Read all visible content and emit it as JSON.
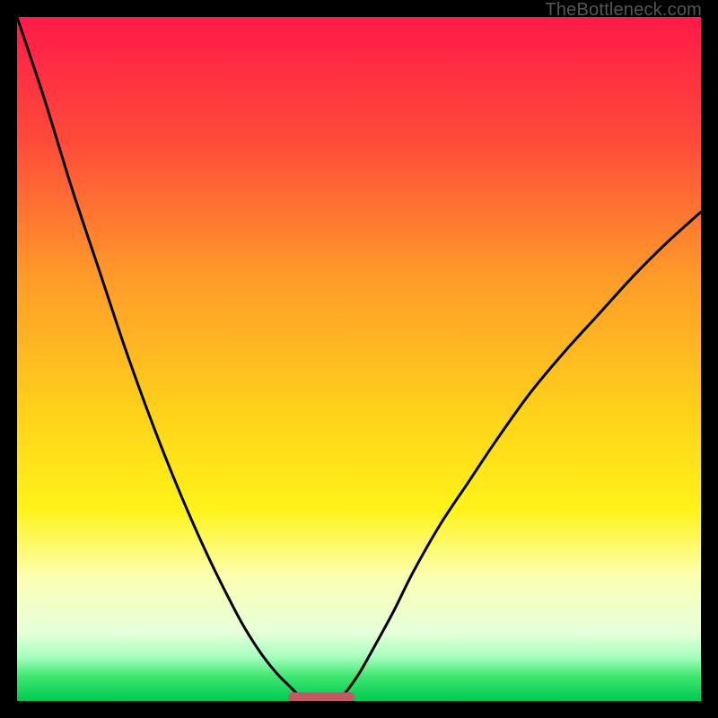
{
  "watermark": "TheBottleneck.com",
  "chart_data": {
    "type": "line",
    "title": "",
    "xlabel": "",
    "ylabel": "",
    "xlim": [
      0,
      100
    ],
    "ylim": [
      0,
      100
    ],
    "grid": false,
    "legend": false,
    "background_gradient": {
      "stops": [
        {
          "offset": 0.0,
          "color": "#ff1a49"
        },
        {
          "offset": 0.18,
          "color": "#ff4a3a"
        },
        {
          "offset": 0.38,
          "color": "#ff9b2a"
        },
        {
          "offset": 0.58,
          "color": "#ffd21a"
        },
        {
          "offset": 0.72,
          "color": "#fff31a"
        },
        {
          "offset": 0.82,
          "color": "#fcffb4"
        },
        {
          "offset": 0.9,
          "color": "#e6ffda"
        },
        {
          "offset": 0.935,
          "color": "#a8ffc0"
        },
        {
          "offset": 0.965,
          "color": "#3de66e"
        },
        {
          "offset": 1.0,
          "color": "#00c853"
        }
      ]
    },
    "left_curve": {
      "note": "descending from top-left to trough near x≈42",
      "x": [
        0,
        4,
        8,
        12,
        16,
        20,
        24,
        28,
        32,
        34,
        36,
        38,
        40,
        41,
        42
      ],
      "y": [
        100,
        88,
        75,
        63,
        51,
        40,
        30,
        21,
        13,
        9.5,
        6.5,
        4.0,
        2.0,
        1.0,
        0.3
      ]
    },
    "right_curve": {
      "note": "ascending from trough near x≈47 to right side",
      "x": [
        47,
        48,
        50,
        52,
        55,
        58,
        62,
        66,
        70,
        75,
        80,
        85,
        90,
        95,
        100
      ],
      "y": [
        0.3,
        1.2,
        4.0,
        7.5,
        13,
        19,
        26,
        32,
        38,
        45,
        51,
        56.5,
        62,
        67,
        71.5
      ]
    },
    "trough_marker": {
      "note": "rounded segment at bottom between curves",
      "x_center": 44.5,
      "half_width": 4.2,
      "y": 0.6,
      "color": "#c25a63",
      "stroke_width_px": 10
    },
    "curve_style": {
      "stroke": "#000000",
      "stroke_width_px": 3
    }
  }
}
